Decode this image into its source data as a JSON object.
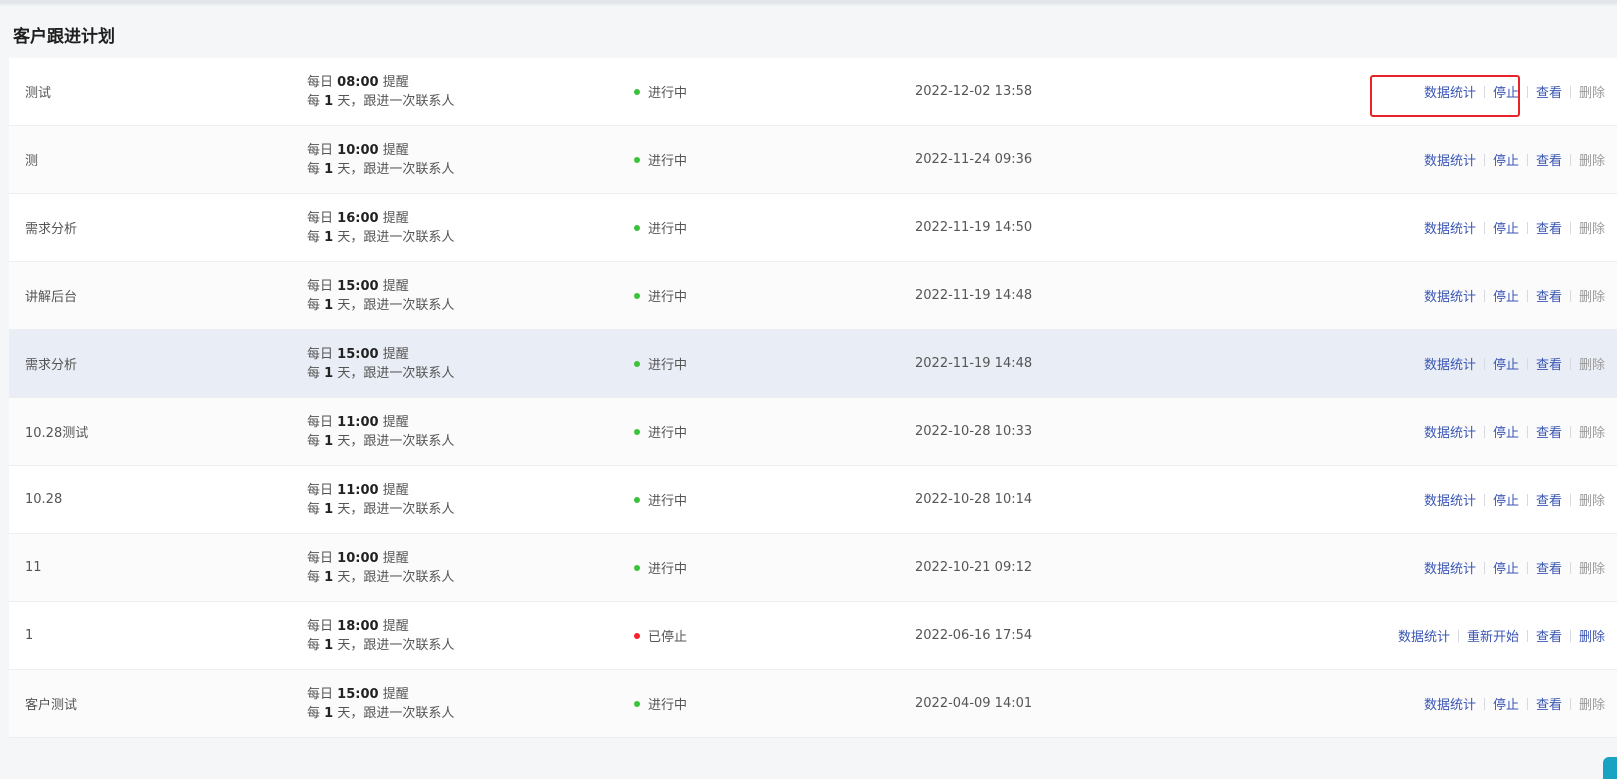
{
  "page": {
    "title": "客户跟进计划"
  },
  "schedule_text": {
    "daily_prefix": "每日",
    "remind_suffix": "提醒",
    "every_prefix": "每",
    "contact_suffix": "天，跟进一次联系人"
  },
  "rows": [
    {
      "name": "测试",
      "time": "08:00",
      "days": "1",
      "status": "进行中",
      "status_type": "running",
      "created": "2022-12-02 13:58",
      "actions": [
        "数据统计",
        "停止",
        "查看",
        "删除"
      ]
    },
    {
      "name": "测",
      "time": "10:00",
      "days": "1",
      "status": "进行中",
      "status_type": "running",
      "created": "2022-11-24 09:36",
      "actions": [
        "数据统计",
        "停止",
        "查看",
        "删除"
      ]
    },
    {
      "name": "需求分析",
      "time": "16:00",
      "days": "1",
      "status": "进行中",
      "status_type": "running",
      "created": "2022-11-19 14:50",
      "actions": [
        "数据统计",
        "停止",
        "查看",
        "删除"
      ]
    },
    {
      "name": "讲解后台",
      "time": "15:00",
      "days": "1",
      "status": "进行中",
      "status_type": "running",
      "created": "2022-11-19 14:48",
      "actions": [
        "数据统计",
        "停止",
        "查看",
        "删除"
      ]
    },
    {
      "name": "需求分析",
      "time": "15:00",
      "days": "1",
      "status": "进行中",
      "status_type": "running",
      "created": "2022-11-19 14:48",
      "actions": [
        "数据统计",
        "停止",
        "查看",
        "删除"
      ]
    },
    {
      "name": "10.28测试",
      "time": "11:00",
      "days": "1",
      "status": "进行中",
      "status_type": "running",
      "created": "2022-10-28 10:33",
      "actions": [
        "数据统计",
        "停止",
        "查看",
        "删除"
      ]
    },
    {
      "name": "10.28",
      "time": "11:00",
      "days": "1",
      "status": "进行中",
      "status_type": "running",
      "created": "2022-10-28 10:14",
      "actions": [
        "数据统计",
        "停止",
        "查看",
        "删除"
      ]
    },
    {
      "name": "11",
      "time": "10:00",
      "days": "1",
      "status": "进行中",
      "status_type": "running",
      "created": "2022-10-21 09:12",
      "actions": [
        "数据统计",
        "停止",
        "查看",
        "删除"
      ]
    },
    {
      "name": "1",
      "time": "18:00",
      "days": "1",
      "status": "已停止",
      "status_type": "stopped",
      "created": "2022-06-16 17:54",
      "actions": [
        "数据统计",
        "重新开始",
        "查看",
        "删除"
      ]
    },
    {
      "name": "客户测试",
      "time": "15:00",
      "days": "1",
      "status": "进行中",
      "status_type": "running",
      "created": "2022-04-09 14:01",
      "actions": [
        "数据统计",
        "停止",
        "查看",
        "删除"
      ]
    }
  ],
  "colors": {
    "link": "#3a56b5",
    "muted": "#999999",
    "running": "#3cc13b",
    "stopped": "#f5222d",
    "focus_outline": "#e8242a"
  }
}
